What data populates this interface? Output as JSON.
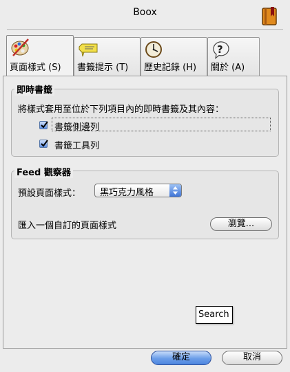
{
  "window": {
    "title": "Boox"
  },
  "tabs": [
    {
      "label": "頁面樣式 (S)",
      "icon": "palette-icon",
      "active": true
    },
    {
      "label": "書籤提示 (T)",
      "icon": "tag-icon",
      "active": false
    },
    {
      "label": "歷史記錄 (H)",
      "icon": "clock-icon",
      "active": false
    },
    {
      "label": "關於 (A)",
      "icon": "question-bubble-icon",
      "active": false
    }
  ],
  "instant_bookmarks": {
    "title": "即時書籤",
    "description": "將樣式套用至位於下列項目內的即時書籤及其內容：",
    "options": [
      {
        "label": "書籤側邊列",
        "checked": true
      },
      {
        "label": "書籤工具列",
        "checked": true
      }
    ]
  },
  "feed_viewer": {
    "title": "Feed 觀察器",
    "default_style_label": "預設頁面樣式：",
    "default_style_value": "黑巧克力風格",
    "import_label": "匯入一個自訂的頁面樣式",
    "browse_label": "瀏覽..."
  },
  "tooltip": {
    "text": "Search"
  },
  "footer": {
    "ok_label": "確定",
    "cancel_label": "取消"
  },
  "colors": {
    "accent": "#4d86e0",
    "window_bg": "#ececec"
  }
}
